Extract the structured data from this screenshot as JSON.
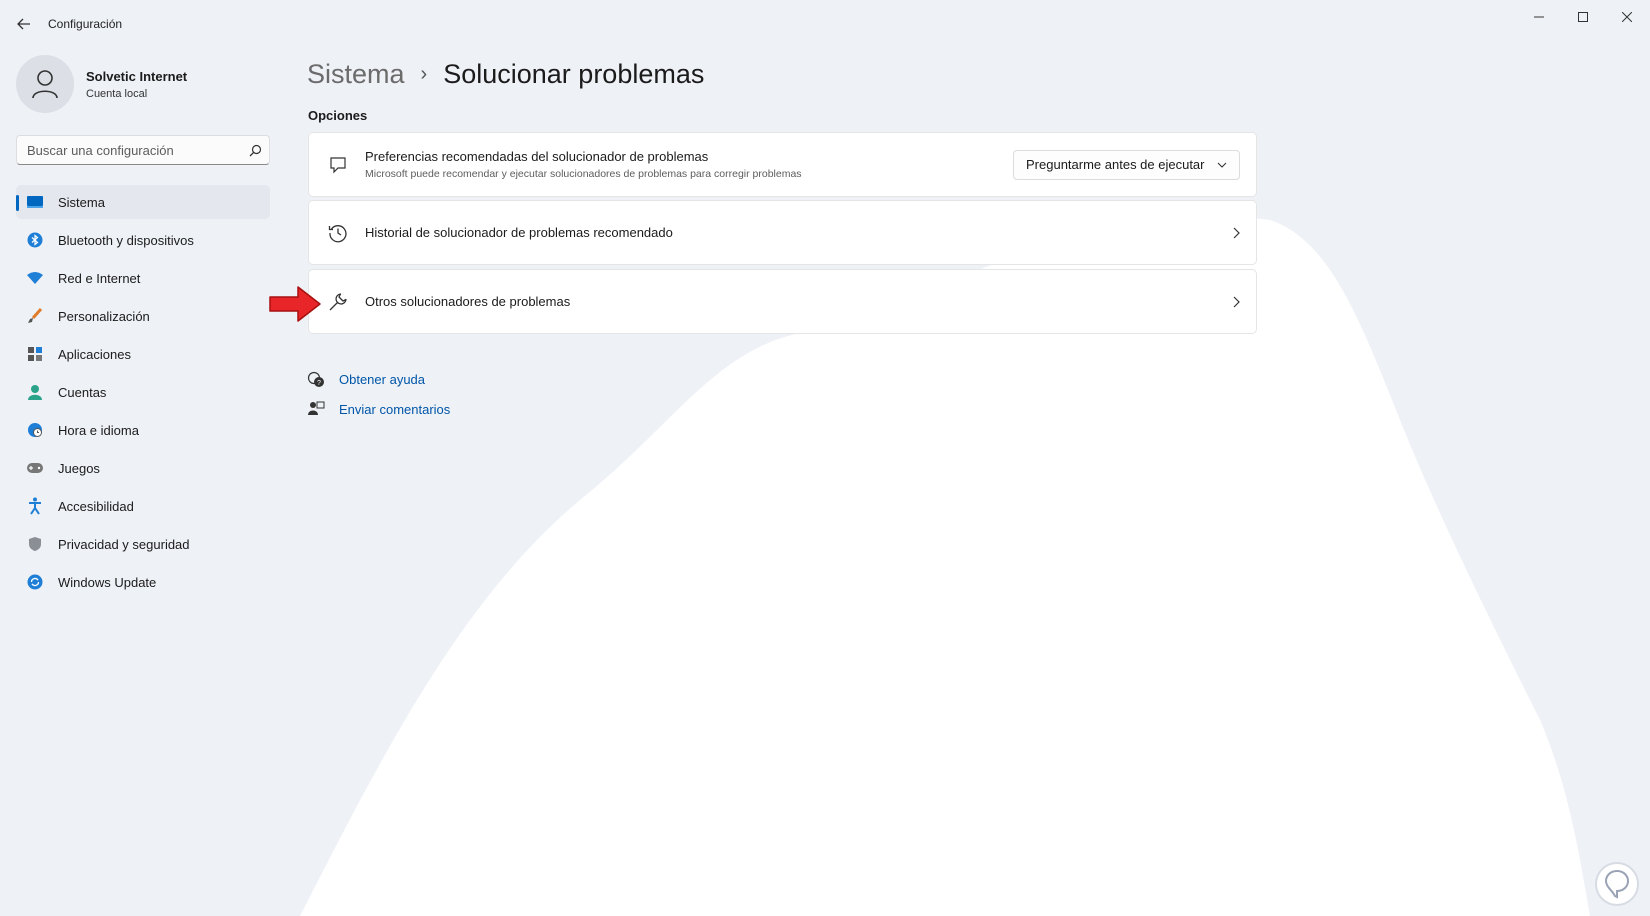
{
  "window": {
    "title": "Configuración",
    "back_icon": "back-arrow-icon",
    "controls": [
      "minimize-icon",
      "maximize-icon",
      "close-icon"
    ]
  },
  "profile": {
    "name": "Solvetic Internet",
    "subtitle": "Cuenta local"
  },
  "search": {
    "placeholder": "Buscar una configuración"
  },
  "sidebar": {
    "items": [
      {
        "label": "Sistema",
        "icon": "system-icon",
        "active": true
      },
      {
        "label": "Bluetooth y dispositivos",
        "icon": "bluetooth-icon",
        "active": false
      },
      {
        "label": "Red e Internet",
        "icon": "wifi-icon",
        "active": false
      },
      {
        "label": "Personalización",
        "icon": "brush-icon",
        "active": false
      },
      {
        "label": "Aplicaciones",
        "icon": "apps-icon",
        "active": false
      },
      {
        "label": "Cuentas",
        "icon": "accounts-icon",
        "active": false
      },
      {
        "label": "Hora e idioma",
        "icon": "globe-clock-icon",
        "active": false
      },
      {
        "label": "Juegos",
        "icon": "gamepad-icon",
        "active": false
      },
      {
        "label": "Accesibilidad",
        "icon": "accessibility-icon",
        "active": false
      },
      {
        "label": "Privacidad y seguridad",
        "icon": "shield-icon",
        "active": false
      },
      {
        "label": "Windows Update",
        "icon": "update-icon",
        "active": false
      }
    ]
  },
  "main": {
    "breadcrumb": {
      "parent": "Sistema",
      "separator": "›",
      "current": "Solucionar problemas"
    },
    "section_label": "Opciones",
    "cards": {
      "preferences": {
        "title": "Preferencias recomendadas del solucionador de problemas",
        "description": "Microsoft puede recomendar y ejecutar solucionadores de problemas para corregir problemas",
        "dropdown_value": "Preguntarme antes de ejecutar"
      },
      "history": {
        "title": "Historial de solucionador de problemas recomendado"
      },
      "others": {
        "title": "Otros solucionadores de problemas"
      }
    },
    "links": {
      "help": "Obtener ayuda",
      "feedback": "Enviar comentarios"
    }
  },
  "colors": {
    "accent": "#0067c0",
    "link": "#0056a8",
    "background": "#eef1f6",
    "annotation_arrow": "#e8262a"
  }
}
